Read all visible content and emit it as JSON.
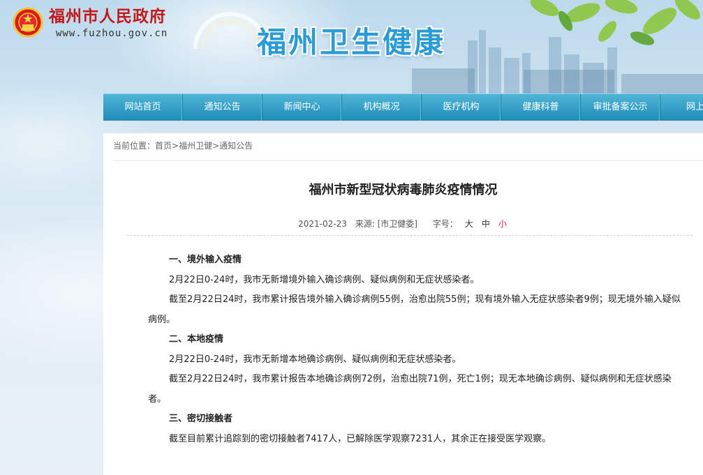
{
  "header": {
    "site_name": "福州市人民政府",
    "site_url": "www.fuzhou.gov.cn",
    "banner_title": "福州卫生健康"
  },
  "nav": {
    "items": [
      "网站首页",
      "通知公告",
      "新闻中心",
      "机构概况",
      "医疗机构",
      "健康科普",
      "审批备案公示",
      "网上办"
    ]
  },
  "breadcrumb": {
    "prefix": "当前位置：",
    "items": [
      "首页",
      "福州卫健",
      "通知公告"
    ],
    "separator": ">"
  },
  "article": {
    "title": "福州市新型冠状病毒肺炎疫情情况",
    "date": "2021-02-23",
    "source": "来源: [市卫健委]",
    "font_size_label": "字号：",
    "font_sizes": [
      "大",
      "中",
      "小"
    ],
    "active_font_size": "小",
    "paragraphs": [
      {
        "type": "heading",
        "text": "一、境外输入疫情"
      },
      {
        "type": "text",
        "text": "2月22日0-24时，我市无新增境外输入确诊病例、疑似病例和无症状感染者。"
      },
      {
        "type": "text",
        "text": "截至2月22日24时，我市累计报告境外输入确诊病例55例，治愈出院55例；现有境外输入无症状感染者9例；现无境外输入疑似病例。"
      },
      {
        "type": "heading",
        "text": "二、本地疫情"
      },
      {
        "type": "text",
        "text": "2月22日0-24时，我市无新增本地确诊病例、疑似病例和无症状感染者。"
      },
      {
        "type": "text",
        "text": "截至2月22日24时，我市累计报告本地确诊病例72例，治愈出院71例，死亡1例；现无本地确诊病例、疑似病例和无症状感染者。"
      },
      {
        "type": "heading",
        "text": "三、密切接触者"
      },
      {
        "type": "text",
        "text": "截至目前累计追踪到的密切接触者7417人，已解除医学观察7231人，其余正在接受医学观察。"
      }
    ]
  },
  "colors": {
    "site_name": "#c21a1a",
    "banner_title": "#2b9bd5",
    "nav_top": "#4fb5d6",
    "nav_bottom": "#1f8cb7",
    "active_font_size": "#dd2233"
  },
  "icons": {
    "logo": "national-emblem-icon"
  }
}
